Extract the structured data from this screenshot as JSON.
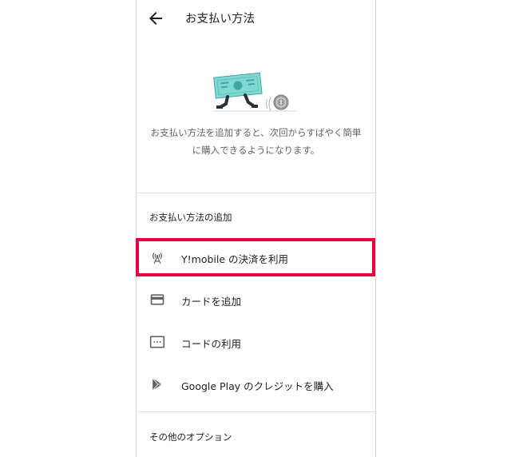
{
  "header": {
    "title": "お支払い方法",
    "back_icon": "arrow-back-icon"
  },
  "illustration": {
    "icon": "running-bill-illustration"
  },
  "description": "お支払い方法を追加すると、次回からすばやく簡単に購入できるようになります。",
  "sections": {
    "add_label": "お支払い方法の追加",
    "other_label": "その他のオプション"
  },
  "options": [
    {
      "label": "Y!mobile の決済を利用",
      "icon": "antenna-icon"
    },
    {
      "label": "カードを追加",
      "icon": "credit-card-icon"
    },
    {
      "label": "コードの利用",
      "icon": "redeem-code-icon"
    },
    {
      "label": "Google Play のクレジットを購入",
      "icon": "google-play-icon"
    }
  ],
  "colors": {
    "highlight": "#e8003d",
    "bill": "#7fd8d2",
    "text": "#202124"
  }
}
